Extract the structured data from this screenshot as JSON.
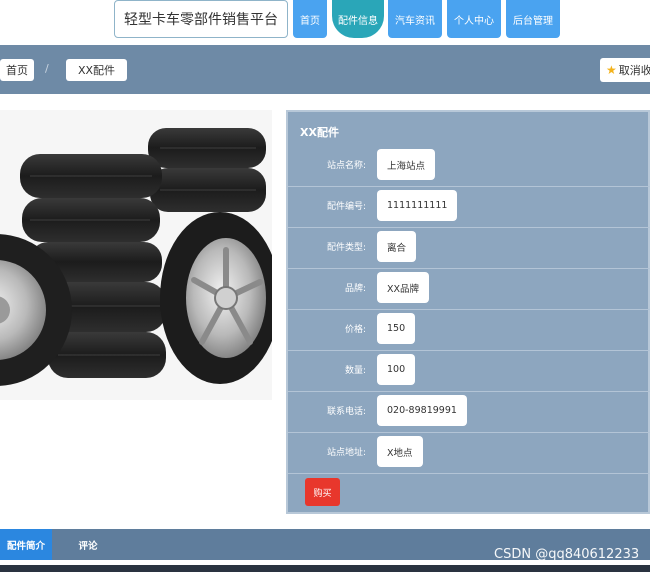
{
  "header": {
    "site_title": "轻型卡车零部件销售平台",
    "nav": [
      "首页",
      "配件信息",
      "汽车资讯",
      "个人中心",
      "后台管理"
    ]
  },
  "breadcrumb": {
    "home": "首页",
    "separator": "/",
    "current": "XX配件",
    "cancel_label": "取消收藏"
  },
  "detail": {
    "title": "XX配件",
    "fields": [
      {
        "label": "站点名称:",
        "value": "上海站点"
      },
      {
        "label": "配件编号:",
        "value": "1111111111"
      },
      {
        "label": "配件类型:",
        "value": "离合"
      },
      {
        "label": "品牌:",
        "value": "XX品牌"
      },
      {
        "label": "价格:",
        "value": "150"
      },
      {
        "label": "数量:",
        "value": "100"
      },
      {
        "label": "联系电话:",
        "value": "020-89819991"
      },
      {
        "label": "站点地址:",
        "value": "X地点"
      }
    ],
    "buy_label": "购买"
  },
  "tabs": [
    "配件简介",
    "评论"
  ],
  "watermark": "CSDN @qq840612233",
  "colors": {
    "nav_blue": "#4aa3f0",
    "nav_active": "#2aa6b8",
    "crumb_bar": "#6e8aa6",
    "panel": "#8da6bf",
    "buy_red": "#e8372c",
    "tab_active": "#2b87e0"
  }
}
